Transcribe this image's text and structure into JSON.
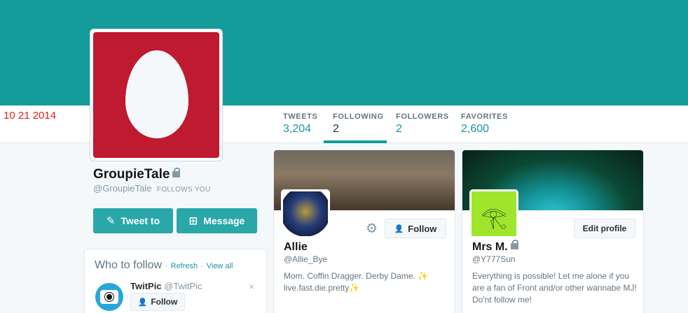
{
  "date_stamp": "10 21 2014",
  "profile": {
    "name": "GroupieTale",
    "handle": "@GroupieTale",
    "follows_you": "FOLLOWS YOU",
    "avatar_color": "#bf1a30",
    "header_color": "#139c99"
  },
  "stats": [
    {
      "label": "TWEETS",
      "value": "3,204"
    },
    {
      "label": "FOLLOWING",
      "value": "2"
    },
    {
      "label": "FOLLOWERS",
      "value": "2"
    },
    {
      "label": "FAVORITES",
      "value": "2,600"
    }
  ],
  "actions": {
    "tweet_to": "Tweet to",
    "message": "Message"
  },
  "who_to_follow": {
    "title": "Who to follow",
    "sep": "·",
    "refresh": "Refresh",
    "view_all": "View all",
    "suggestion": {
      "name": "TwitPic",
      "handle": "@TwitPic",
      "follow_label": "Follow",
      "close": "×"
    }
  },
  "cards": [
    {
      "name": "Allie",
      "handle": "@Allie_Bye",
      "bio": "Mom. Coffin Dragger. Derby Dame. ✨ live.fast.die.pretty✨",
      "follow_label": "Follow",
      "gear": "⚙"
    },
    {
      "name": "Mrs M.",
      "handle": "@Y777Sun",
      "bio": "Everything is possible! Let me alone if you are a fan of Front and/or other wannabe MJ! Do'nt follow me!",
      "edit_label": "Edit profile",
      "avatar_symbol": "𓂀"
    }
  ],
  "icons": {
    "tweet_to": "compose-icon",
    "message": "message-icon",
    "follow": "follow-person-icon",
    "lock": "lock-icon",
    "gear": "gear-icon",
    "camera": "camera-icon"
  }
}
